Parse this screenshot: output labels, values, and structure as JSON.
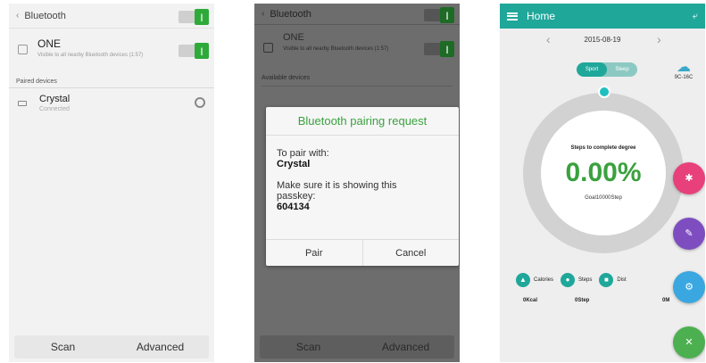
{
  "screen1": {
    "header": {
      "title": "Bluetooth"
    },
    "device_one": {
      "name": "ONE",
      "desc": "Visible to all nearby Bluetooth devices (1:57)"
    },
    "paired_label": "Paired devices",
    "paired_device": {
      "name": "Crystal",
      "state": "Connected"
    },
    "bottom": {
      "scan": "Scan",
      "advanced": "Advanced"
    }
  },
  "screen2": {
    "header": {
      "title": "Bluetooth"
    },
    "device_one": {
      "name": "ONE",
      "desc": "Visible to all nearby Bluetooth devices (1:57)"
    },
    "available_label": "Available devices",
    "dialog": {
      "title": "Bluetooth pairing request",
      "pair_with_label": "To pair with:",
      "device_name": "Crystal",
      "passkey_label": "Make sure it is showing this passkey:",
      "passkey": "604134",
      "pair": "Pair",
      "cancel": "Cancel"
    },
    "bottom": {
      "scan": "Scan",
      "advanced": "Advanced"
    }
  },
  "screen3": {
    "header": {
      "title": "Home"
    },
    "date": "2015-08-19",
    "segment": {
      "sport": "Sport",
      "sleep": "Sleep"
    },
    "weather": {
      "temp": "9C-16C"
    },
    "ring": {
      "label": "Steps to complete degree",
      "percent": "0.00%",
      "goal": "Goal10000Step",
      "progress": 0
    },
    "stats": {
      "calories_label": "Calories",
      "calories_value": "0Kcal",
      "steps_label": "Steps",
      "steps_value": "0Step",
      "distance_label": "Dist",
      "distance_value": "0M"
    },
    "colors": {
      "teal": "#1fa79a",
      "pink": "#e8407a",
      "purple": "#7e4ec0",
      "blue": "#3aa7e0",
      "green": "#4cb050"
    }
  }
}
